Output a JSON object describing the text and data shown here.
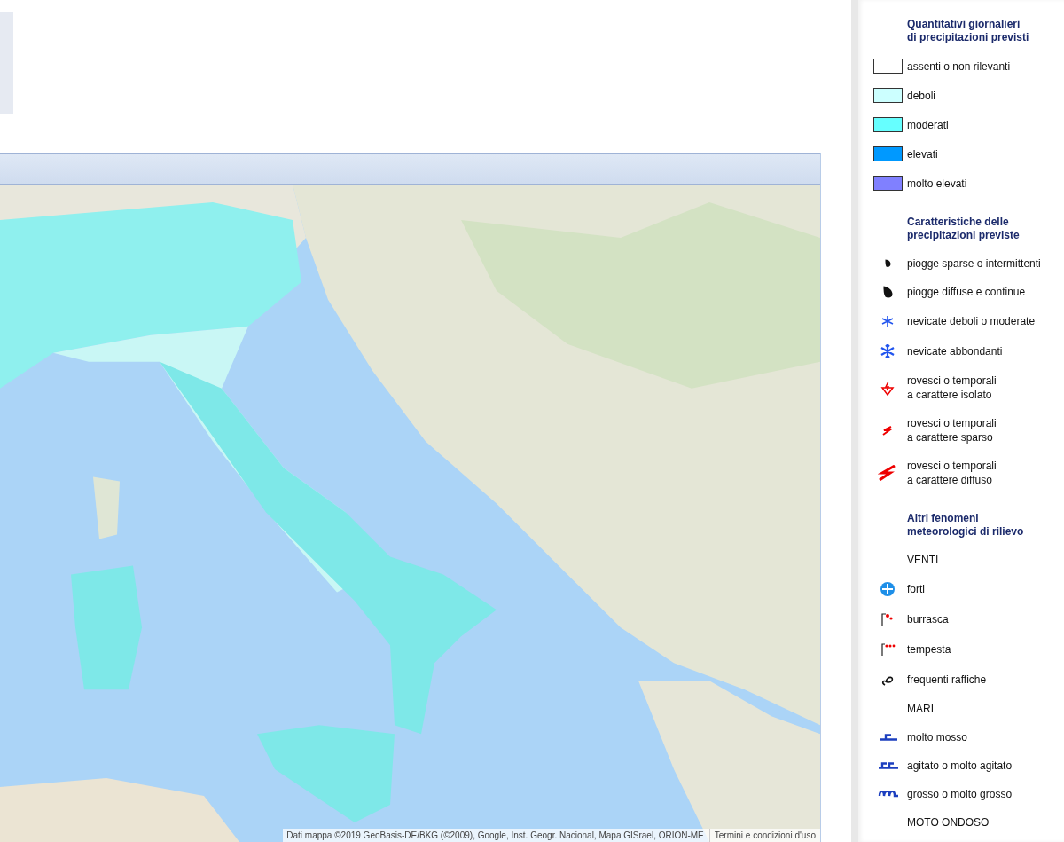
{
  "map": {
    "kind": "picture",
    "attribution": "Dati mappa ©2019 GeoBasis-DE/BKG (©2009), Google, Inst. Geogr. Nacional, Mapa GISrael, ORION-ME",
    "terms_link": "Termini e condizioni d'uso"
  },
  "legend": {
    "sections": [
      {
        "title": "Quantitativi giornalieri\ndi precipitazioni previsti",
        "items": [
          {
            "kind": "swatch",
            "color": "#ffffff",
            "label": "assenti o non rilevanti"
          },
          {
            "kind": "swatch",
            "color": "#ccffff",
            "label": "deboli"
          },
          {
            "kind": "swatch",
            "color": "#66ffff",
            "label": "moderati"
          },
          {
            "kind": "swatch",
            "color": "#0099ff",
            "label": "elevati"
          },
          {
            "kind": "swatch",
            "color": "#8080ff",
            "label": "molto elevati"
          }
        ]
      },
      {
        "title": "Caratteristiche delle\nprecipitazioni previste",
        "items": [
          {
            "kind": "drop",
            "label": "piogge sparse o intermittenti"
          },
          {
            "kind": "bigdrop",
            "label": "piogge diffuse e continue"
          },
          {
            "kind": "snowflake",
            "label": "nevicate deboli o moderate"
          },
          {
            "kind": "bigsnowflake",
            "label": "nevicate abbondanti"
          },
          {
            "kind": "stormcone",
            "label": "rovesci o temporali\na carattere isolato"
          },
          {
            "kind": "bolt",
            "label": "rovesci o temporali\na carattere sparso"
          },
          {
            "kind": "bigbolt",
            "label": "rovesci o temporali\na carattere diffuso"
          }
        ]
      },
      {
        "title": "Altri fenomeni\nmeteorologici di rilievo",
        "items": [
          {
            "kind": "heading",
            "label": "VENTI"
          },
          {
            "kind": "windrose",
            "label": "forti"
          },
          {
            "kind": "flagtwo",
            "label": "burrasca"
          },
          {
            "kind": "flagthree",
            "label": "tempesta"
          },
          {
            "kind": "gust",
            "label": "frequenti raffiche"
          },
          {
            "kind": "heading",
            "label": "MARI"
          },
          {
            "kind": "waveone",
            "label": "molto mosso"
          },
          {
            "kind": "wavetwo",
            "label": "agitato o molto agitato"
          },
          {
            "kind": "wavethree",
            "label": "grosso o molto grosso"
          },
          {
            "kind": "heading",
            "label": "MOTO ONDOSO"
          }
        ]
      }
    ]
  }
}
